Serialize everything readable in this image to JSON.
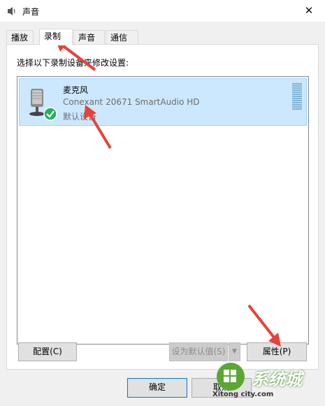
{
  "window": {
    "title": "声音",
    "close_glyph": "✕"
  },
  "tabs": [
    {
      "label": "播放",
      "active": false
    },
    {
      "label": "录制",
      "active": true
    },
    {
      "label": "声音",
      "active": false
    },
    {
      "label": "通信",
      "active": false
    }
  ],
  "recording": {
    "instruction": "选择以下录制设备来修改设置:",
    "devices": [
      {
        "name": "麦克风",
        "description": "Conexant 20671 SmartAudio HD",
        "status": "默认设备",
        "icon": "microphone-icon",
        "default_badge": "checkmark-icon",
        "selected": true
      }
    ]
  },
  "buttons": {
    "configure": "配置(C)",
    "set_default": "设为默认值(S)",
    "set_default_arrow": "▼",
    "properties": "属性(P)",
    "ok": "确定",
    "cancel": "取消"
  },
  "watermark": {
    "text": "系统城",
    "sub": "Xitong city.com"
  },
  "colors": {
    "selection": "#cce8ff",
    "selection_border": "#99d1ff",
    "annotation_arrow": "#e8413a",
    "default_badge": "#27ae60"
  }
}
